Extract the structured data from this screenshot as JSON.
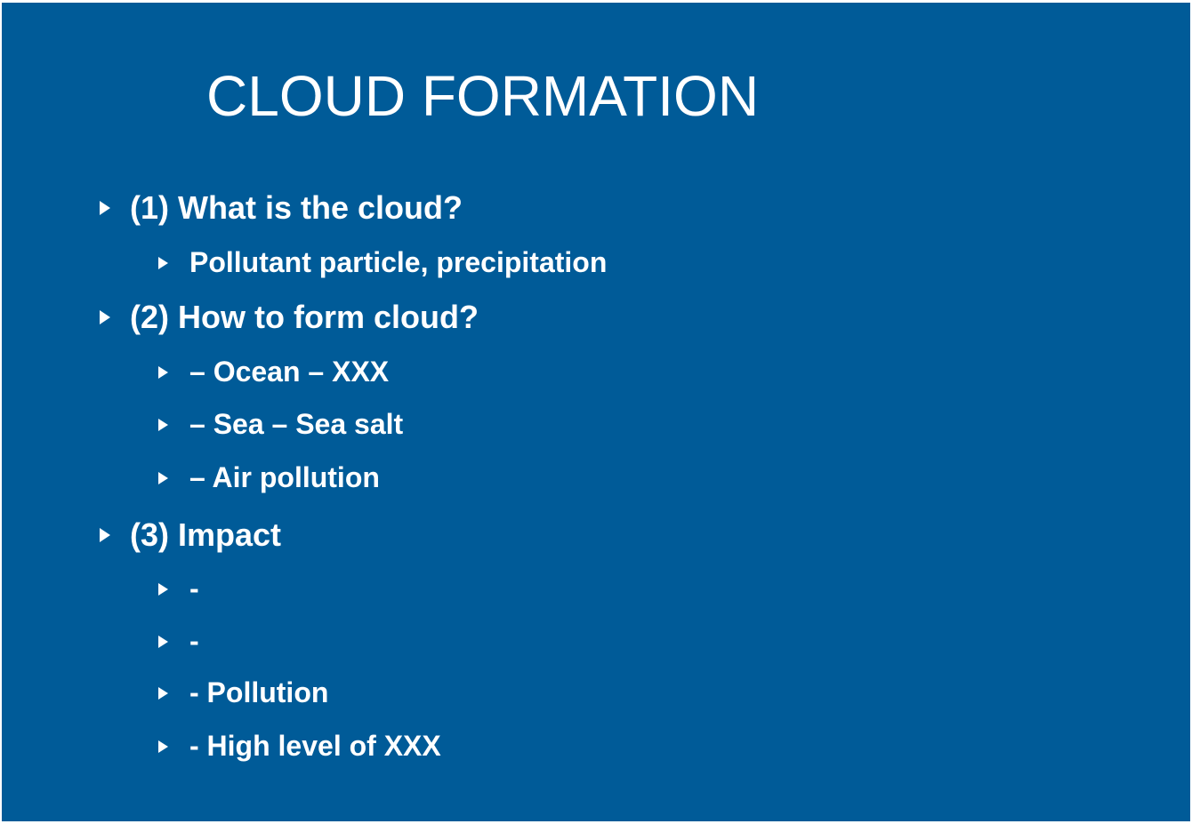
{
  "slide": {
    "title": "CLOUD FORMATION",
    "background_color": "#005b98",
    "text_color": "#ffffff",
    "bullet_icon": "triangle-right-icon",
    "items": [
      {
        "level": 1,
        "text": "(1) What is the cloud?"
      },
      {
        "level": 2,
        "text": "Pollutant particle, precipitation"
      },
      {
        "level": 1,
        "text": "(2) How to form cloud?"
      },
      {
        "level": 2,
        "text": "– Ocean –  XXX"
      },
      {
        "level": 2,
        "text": "– Sea – Sea salt"
      },
      {
        "level": 2,
        "text": "– Air pollution"
      },
      {
        "level": 1,
        "text": "(3) Impact"
      },
      {
        "level": 2,
        "text": "-"
      },
      {
        "level": 2,
        "text": "-"
      },
      {
        "level": 2,
        "text": "- Pollution"
      },
      {
        "level": 2,
        "text": "- High level of XXX"
      }
    ]
  }
}
